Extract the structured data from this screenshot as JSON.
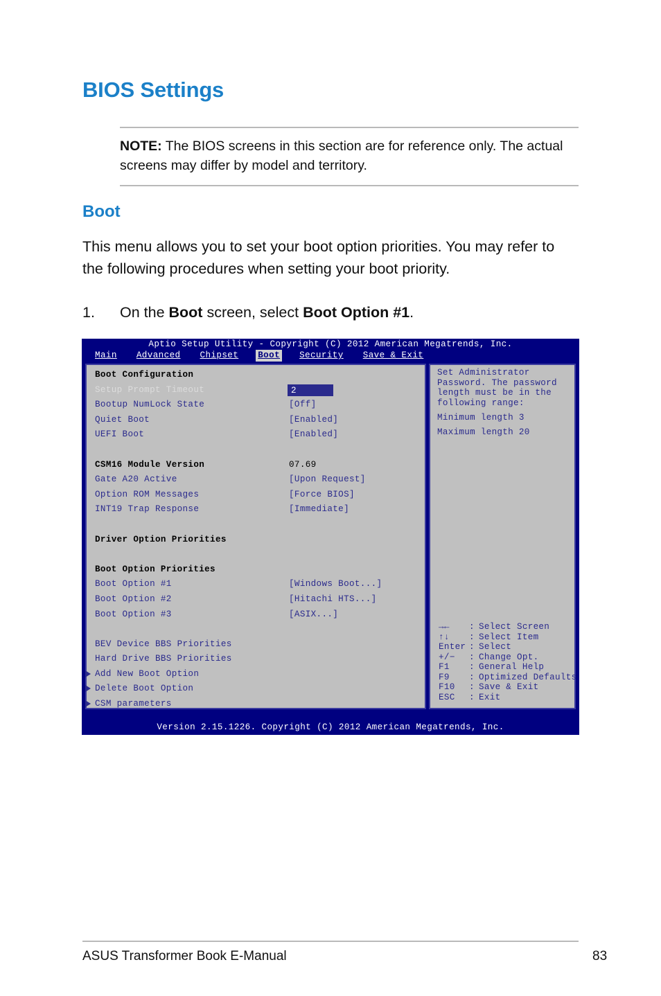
{
  "document": {
    "title": "BIOS Settings",
    "note": {
      "label": "NOTE:",
      "text": " The BIOS screens in this section are for reference only. The actual screens may differ by model and territory."
    },
    "section_heading": "Boot",
    "body_paragraph": "This menu allows you to set your boot option priorities. You may refer to the following procedures when setting your boot priority.",
    "step": {
      "number": "1.",
      "prefix": "On the ",
      "bold1": "Boot",
      "middle": " screen, select ",
      "bold2": "Boot Option #1",
      "suffix": "."
    },
    "footer": {
      "left": "ASUS Transformer Book E-Manual",
      "page": "83"
    },
    "accent_color": "#1b80c8"
  },
  "bios": {
    "titlebar": "Aptio Setup Utility - Copyright (C) 2012 American Megatrends, Inc.",
    "statusbar": "Version 2.15.1226. Copyright (C) 2012 American Megatrends, Inc.",
    "menu": [
      {
        "label": "Main",
        "active": false
      },
      {
        "label": "Advanced",
        "active": false
      },
      {
        "label": "Chipset",
        "active": false
      },
      {
        "label": "Boot",
        "active": true
      },
      {
        "label": "Security",
        "active": false
      },
      {
        "label": "Save & Exit",
        "active": false
      }
    ],
    "colors": {
      "chrome": "#000080",
      "panel": "#c0c0c0",
      "text": "#2a2a8c",
      "highlight": "#2a2a8c"
    },
    "rows": [
      {
        "label": "Boot Configuration",
        "value": "",
        "style": "header"
      },
      {
        "label": "Setup Prompt Timeout",
        "value": "2",
        "style": "selected"
      },
      {
        "label": "Bootup NumLock State",
        "value": "[Off]",
        "style": "normal"
      },
      {
        "label": "Quiet Boot",
        "value": "[Enabled]",
        "style": "normal"
      },
      {
        "label": "UEFI Boot",
        "value": "[Enabled]",
        "style": "normal"
      },
      {
        "label": "",
        "value": "",
        "style": "spacer"
      },
      {
        "label": "CSM16 Module Version",
        "value": "07.69",
        "style": "header-value"
      },
      {
        "label": "Gate A20 Active",
        "value": "[Upon Request]",
        "style": "normal"
      },
      {
        "label": "Option ROM Messages",
        "value": "[Force BIOS]",
        "style": "normal"
      },
      {
        "label": "INT19 Trap Response",
        "value": "[Immediate]",
        "style": "normal"
      },
      {
        "label": "",
        "value": "",
        "style": "spacer"
      },
      {
        "label": "Driver Option Priorities",
        "value": "",
        "style": "header"
      },
      {
        "label": "",
        "value": "",
        "style": "spacer"
      },
      {
        "label": "Boot Option Priorities",
        "value": "",
        "style": "header"
      },
      {
        "label": "Boot Option #1",
        "value": "[Windows Boot...]",
        "style": "normal"
      },
      {
        "label": "Boot Option #2",
        "value": "[Hitachi HTS...]",
        "style": "normal"
      },
      {
        "label": "Boot Option #3",
        "value": "[ASIX...]",
        "style": "normal"
      },
      {
        "label": "",
        "value": "",
        "style": "spacer"
      },
      {
        "label": "BEV Device BBS Priorities",
        "value": "",
        "style": "normal"
      },
      {
        "label": "Hard Drive BBS Priorities",
        "value": "",
        "style": "normal"
      },
      {
        "label": "Add New Boot Option",
        "value": "",
        "style": "submenu"
      },
      {
        "label": "Delete Boot Option",
        "value": "",
        "style": "submenu"
      },
      {
        "label": "CSM parameters",
        "value": "",
        "style": "submenu"
      }
    ],
    "help": [
      {
        "text": "Set Administrator",
        "gap": false
      },
      {
        "text": "Password. The password",
        "gap": false
      },
      {
        "text": "length must be in the",
        "gap": false
      },
      {
        "text": "following range:",
        "gap": true
      },
      {
        "text": "Minimum length 3",
        "gap": true
      },
      {
        "text": "Maximum length 20",
        "gap": false
      }
    ],
    "keys": [
      {
        "key": "→←",
        "sep": ":",
        "action": "Select Screen"
      },
      {
        "key": "↑↓",
        "sep": ":",
        "action": "Select Item"
      },
      {
        "key": "Enter",
        "sep": ":",
        "action": "Select"
      },
      {
        "key": "+/−",
        "sep": ":",
        "action": "Change Opt."
      },
      {
        "key": "F1",
        "sep": ":",
        "action": "General Help"
      },
      {
        "key": "F9",
        "sep": ":",
        "action": "Optimized Defaults"
      },
      {
        "key": "F10",
        "sep": ":",
        "action": "Save & Exit"
      },
      {
        "key": "ESC",
        "sep": ":",
        "action": "Exit"
      }
    ]
  }
}
